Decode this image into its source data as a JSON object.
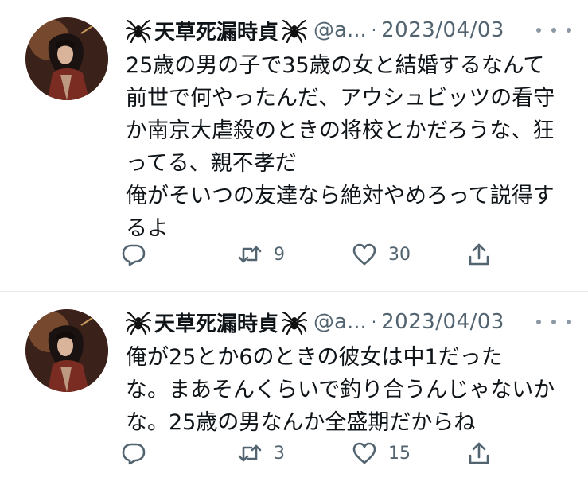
{
  "tweets": [
    {
      "author_name": "天草死漏時貞",
      "handle": "@a...",
      "separator": "·",
      "date": "2023/04/03",
      "text": "25歳の男の子で35歳の女と結婚するなんて\n前世で何やったんだ、アウシュビッツの看守\nか南京大虐殺のときの将校とかだろうな、狂\nってる、親不孝だ\n俺がそいつの友達なら絶対やめろって説得す\nるよ",
      "reply_count": "",
      "retweet_count": "9",
      "like_count": "30"
    },
    {
      "author_name": "天草死漏時貞",
      "handle": "@a...",
      "separator": "·",
      "date": "2023/04/03",
      "text": "俺が25とか6のときの彼女は中1だった\nな。まあそんくらいで釣り合うんじゃないか\nな。25歳の男なんか全盛期だからね",
      "reply_count": "",
      "retweet_count": "3",
      "like_count": "15"
    }
  ],
  "icons": {
    "name_decoration": "spider-icon",
    "more": "more-icon",
    "reply": "reply-icon",
    "retweet": "retweet-icon",
    "like": "like-icon",
    "share": "share-icon"
  },
  "colors": {
    "text": "#0f1419",
    "secondary": "#536471",
    "divider": "#e7e9eb"
  }
}
